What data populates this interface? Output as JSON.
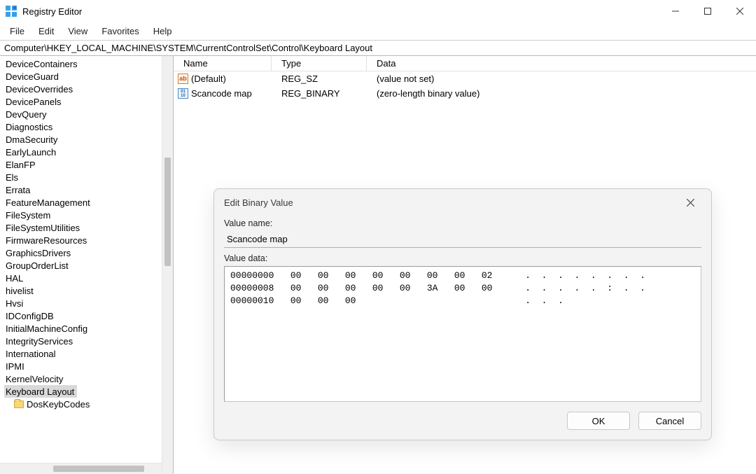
{
  "titlebar": {
    "title": "Registry Editor"
  },
  "menu": {
    "file": "File",
    "edit": "Edit",
    "view": "View",
    "favorites": "Favorites",
    "help": "Help"
  },
  "addressbar": {
    "path": "Computer\\HKEY_LOCAL_MACHINE\\SYSTEM\\CurrentControlSet\\Control\\Keyboard Layout"
  },
  "tree": {
    "items": [
      "DeviceContainers",
      "DeviceGuard",
      "DeviceOverrides",
      "DevicePanels",
      "DevQuery",
      "Diagnostics",
      "DmaSecurity",
      "EarlyLaunch",
      "ElanFP",
      "Els",
      "Errata",
      "FeatureManagement",
      "FileSystem",
      "FileSystemUtilities",
      "FirmwareResources",
      "GraphicsDrivers",
      "GroupOrderList",
      "HAL",
      "hivelist",
      "Hvsi",
      "IDConfigDB",
      "InitialMachineConfig",
      "IntegrityServices",
      "International",
      "IPMI",
      "KernelVelocity",
      "Keyboard Layout"
    ],
    "selected": "Keyboard Layout",
    "child": "DosKeybCodes"
  },
  "list": {
    "headers": {
      "name": "Name",
      "type": "Type",
      "data": "Data"
    },
    "rows": [
      {
        "icon": "str",
        "name": "(Default)",
        "type": "REG_SZ",
        "data": "(value not set)"
      },
      {
        "icon": "bin",
        "name": "Scancode map",
        "type": "REG_BINARY",
        "data": "(zero-length binary value)"
      }
    ]
  },
  "dialog": {
    "title": "Edit Binary Value",
    "value_name_label": "Value name:",
    "value_name": "Scancode map",
    "value_data_label": "Value data:",
    "hex": "00000000   00   00   00   00   00   00   00   02      .  .  .  .  .  .  .  .\n00000008   00   00   00   00   00   3A   00   00      .  .  .  .  .  :  .  .\n00000010   00   00   00                               .  .  .",
    "ok": "OK",
    "cancel": "Cancel"
  }
}
